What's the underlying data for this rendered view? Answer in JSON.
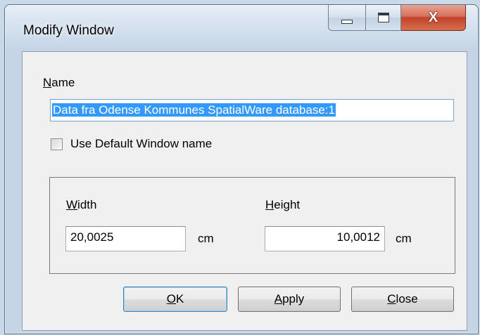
{
  "window": {
    "title": "Modify Window",
    "minimize_icon": "minimize-icon",
    "maximize_icon": "maximize-icon",
    "close_icon": "close-icon",
    "close_glyph": "X"
  },
  "name_section": {
    "label_mnemonic": "N",
    "label_rest": "ame",
    "value": "Data fra Odense Kommunes SpatialWare database:1"
  },
  "default_name_checkbox": {
    "label": "Use Default Window name",
    "checked": false
  },
  "size": {
    "width": {
      "label_mnemonic": "W",
      "label_rest": "idth",
      "value": "20,0025",
      "unit": "cm"
    },
    "height": {
      "label_mnemonic": "H",
      "label_rest": "eight",
      "value": "10,0012",
      "unit": "cm"
    }
  },
  "buttons": {
    "ok": {
      "mnemonic": "O",
      "rest": "K"
    },
    "apply": {
      "mnemonic": "A",
      "rest": "pply"
    },
    "close": {
      "mnemonic": "C",
      "rest": "lose"
    }
  },
  "colors": {
    "selection": "#3399ff",
    "close_button": "#c2432a",
    "focus_border": "#7ea1c9"
  }
}
